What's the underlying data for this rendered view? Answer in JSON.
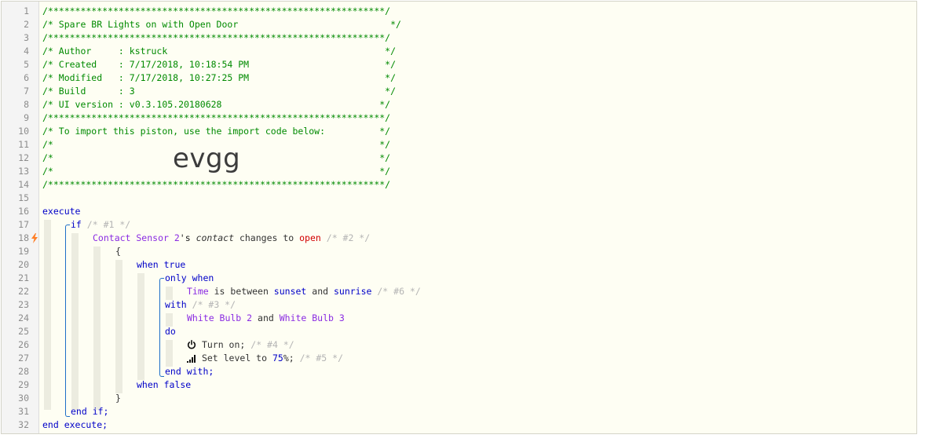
{
  "line_numbers": [
    "1",
    "2",
    "3",
    "4",
    "5",
    "6",
    "7",
    "8",
    "9",
    "10",
    "11",
    "12",
    "13",
    "14",
    "15",
    "16",
    "17",
    "18",
    "19",
    "20",
    "21",
    "22",
    "23",
    "24",
    "25",
    "26",
    "27",
    "28",
    "29",
    "30",
    "31",
    "32"
  ],
  "header": {
    "stars_line": "/**************************************************************/",
    "title_line": "/* Spare BR Lights on with Open Door                            */",
    "author_line": "/* Author     : kstruck                                        */",
    "created_line": "/* Created    : 7/17/2018, 10:18:54 PM                         */",
    "modified_line": "/* Modified   : 7/17/2018, 10:27:25 PM                         */",
    "build_line": "/* Build      : 3                                              */",
    "ui_version_line": "/* UI version : v0.3.105.20180628                             */",
    "import_line": "/* To import this piston, use the import code below:          */",
    "blank_line": "/*                                                            */",
    "import_code": "evgg"
  },
  "code": {
    "execute": "execute",
    "if": "if",
    "if_comment": "/* #1 */",
    "device_contact": "Contact Sensor 2",
    "possessive": "'s ",
    "attribute": "contact",
    "changes_to": " changes to ",
    "open": "open",
    "cond_comment": "/* #2 */",
    "open_brace": "{",
    "when_true": "when true",
    "only_when": "only when",
    "time": "Time",
    "is_between": " is between ",
    "sunset": "sunset",
    "and": " and ",
    "sunrise": "sunrise",
    "time_comment": "/* #6 */",
    "with": "with",
    "with_comment": "/* #3 */",
    "bulb_2": "White Bulb 2",
    "bulb_and": " and ",
    "bulb_3": "White Bulb 3",
    "do": "do",
    "turn_on": "Turn on;",
    "turn_on_comment": "/* #4 */",
    "set_level": "Set level to ",
    "level_value": "75",
    "percent": "%;",
    "level_comment": "/* #5 */",
    "end_with": "end with;",
    "when_false": "when false",
    "close_brace": "}",
    "end_if": "end if;",
    "end_execute": "end execute;"
  },
  "icons": {
    "trigger": "lightning-bolt-icon",
    "power": "power-icon",
    "level": "signal-bars-icon"
  },
  "colors": {
    "comment": "#008a00",
    "keyword": "#0000c8",
    "device": "#8a2be2",
    "value": "#d20000",
    "trigger_bolt": "#ff7f27",
    "background": "#fefef3"
  }
}
